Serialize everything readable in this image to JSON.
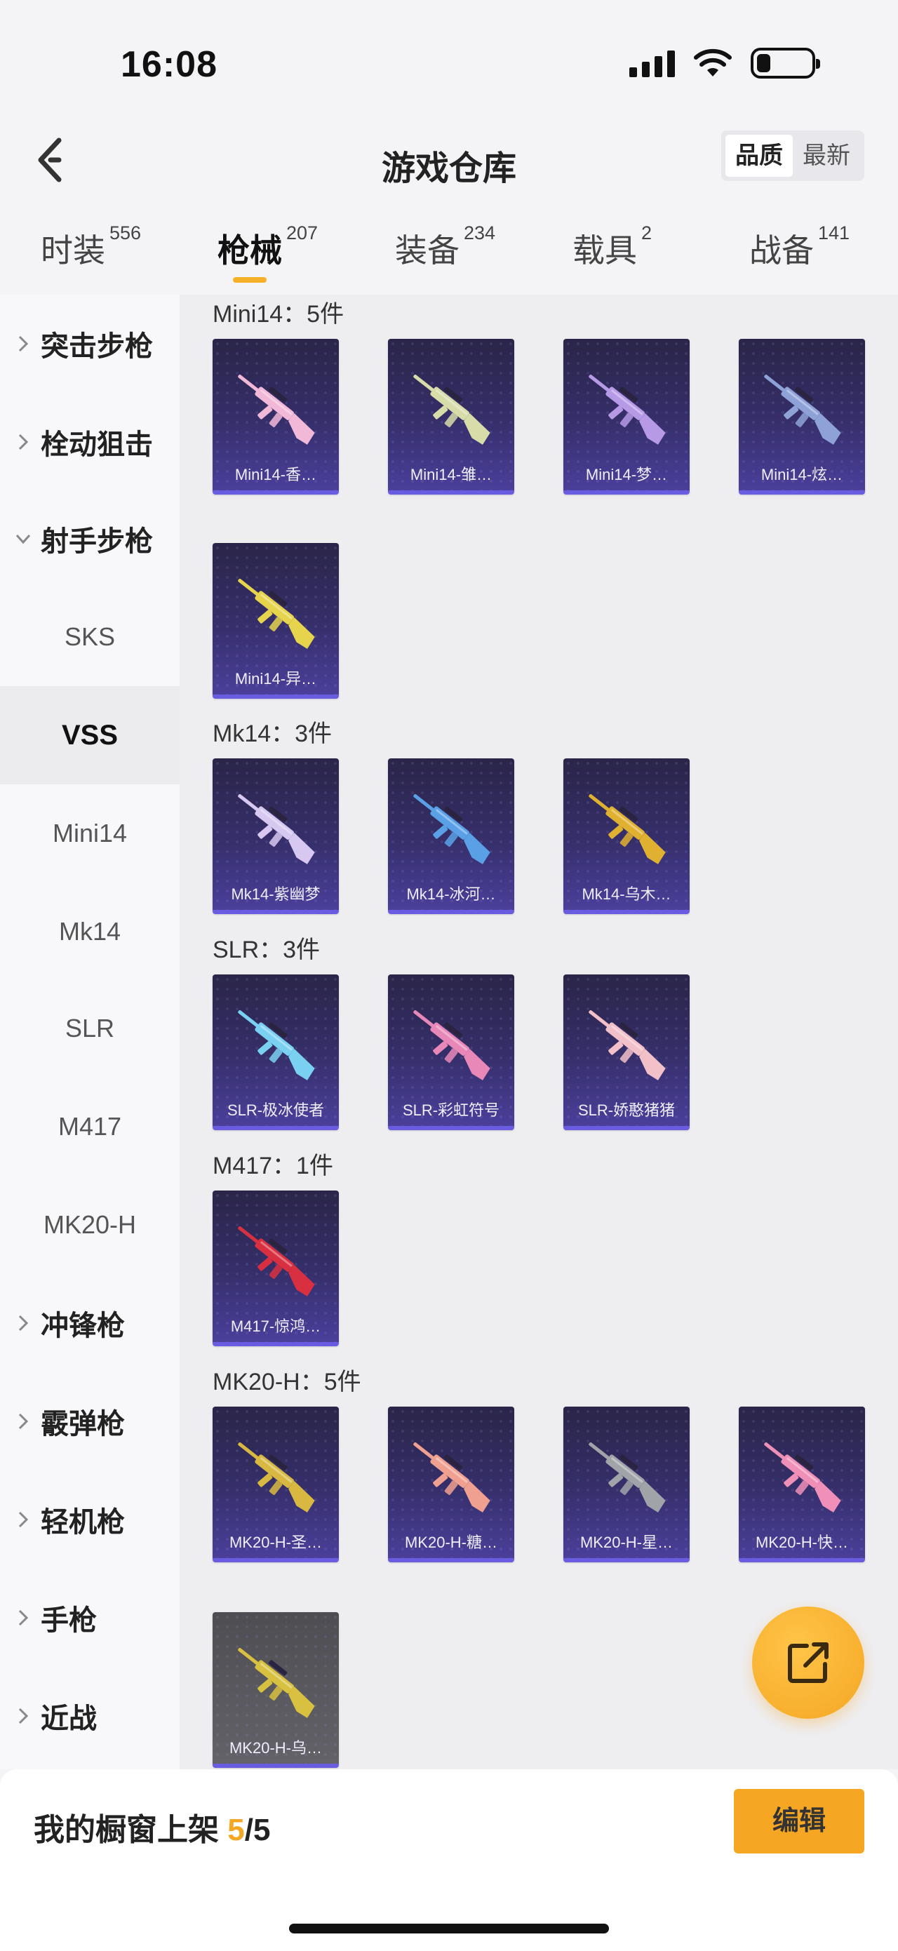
{
  "status_bar": {
    "time": "16:08",
    "icons": [
      "signal-icon",
      "wifi-icon",
      "battery-icon"
    ],
    "battery_level": 0.25
  },
  "header": {
    "title": "游戏仓库",
    "back_icon": "chevron-left-icon",
    "sort": {
      "quality": "品质",
      "newest": "最新",
      "selected": "quality"
    }
  },
  "tabs": [
    {
      "label": "时装",
      "count": "556"
    },
    {
      "label": "枪械",
      "count": "207",
      "active": true
    },
    {
      "label": "装备",
      "count": "234"
    },
    {
      "label": "载具",
      "count": "2"
    },
    {
      "label": "战备",
      "count": "141"
    }
  ],
  "sidebar": {
    "groups": [
      {
        "label": "突击步枪",
        "expanded": false
      },
      {
        "label": "栓动狙击",
        "expanded": false
      },
      {
        "label": "射手步枪",
        "expanded": true
      },
      {
        "label": "冲锋枪",
        "expanded": false
      },
      {
        "label": "霰弹枪",
        "expanded": false
      },
      {
        "label": "轻机枪",
        "expanded": false
      },
      {
        "label": "手枪",
        "expanded": false
      },
      {
        "label": "近战",
        "expanded": false
      }
    ],
    "subitems": [
      "SKS",
      "VSS",
      "Mini14",
      "Mk14",
      "SLR",
      "M417",
      "MK20-H"
    ],
    "selected_subitem": "VSS"
  },
  "sections": [
    {
      "title": "Mini14：5件",
      "items": [
        "Mini14-香…",
        "Mini14-雏…",
        "Mini14-梦…",
        "Mini14-炫…",
        "Mini14-异…"
      ]
    },
    {
      "title": "Mk14：3件",
      "items": [
        "Mk14-紫幽梦",
        "Mk14-冰河…",
        "Mk14-乌木…"
      ]
    },
    {
      "title": "SLR：3件",
      "items": [
        "SLR-极冰使者",
        "SLR-彩虹符号",
        "SLR-娇憨猪猪"
      ]
    },
    {
      "title": "M417：1件",
      "items": [
        "M417-惊鸿…"
      ]
    },
    {
      "title": "MK20-H：5件",
      "items": [
        "MK20-H-圣…",
        "MK20-H-糖…",
        "MK20-H-星…",
        "MK20-H-快…",
        "MK20-H-乌…"
      ]
    }
  ],
  "gun_colors": {
    "mini14": [
      "#f2b8d8",
      "#d7dca8",
      "#b79ae6",
      "#8ea2d8",
      "#e6d44c"
    ],
    "mk14": [
      "#d6c8f0",
      "#5aa0e6",
      "#e0b030"
    ],
    "slr": [
      "#7ad0f0",
      "#e888b8",
      "#f2c0c8"
    ],
    "m417": [
      "#d83040"
    ],
    "mk20": [
      "#d8b840",
      "#f0a090",
      "#a0a4a8",
      "#f090b8",
      "#d8c040"
    ]
  },
  "fab": {
    "icon": "share-icon"
  },
  "bottom_bar": {
    "label": "我的橱窗上架 ",
    "count": "5",
    "total": "/5",
    "edit_label": "编辑"
  },
  "colors": {
    "accent": "#f5a623",
    "card_bg": "#362f6b",
    "card_border": "#6a5ce0"
  }
}
